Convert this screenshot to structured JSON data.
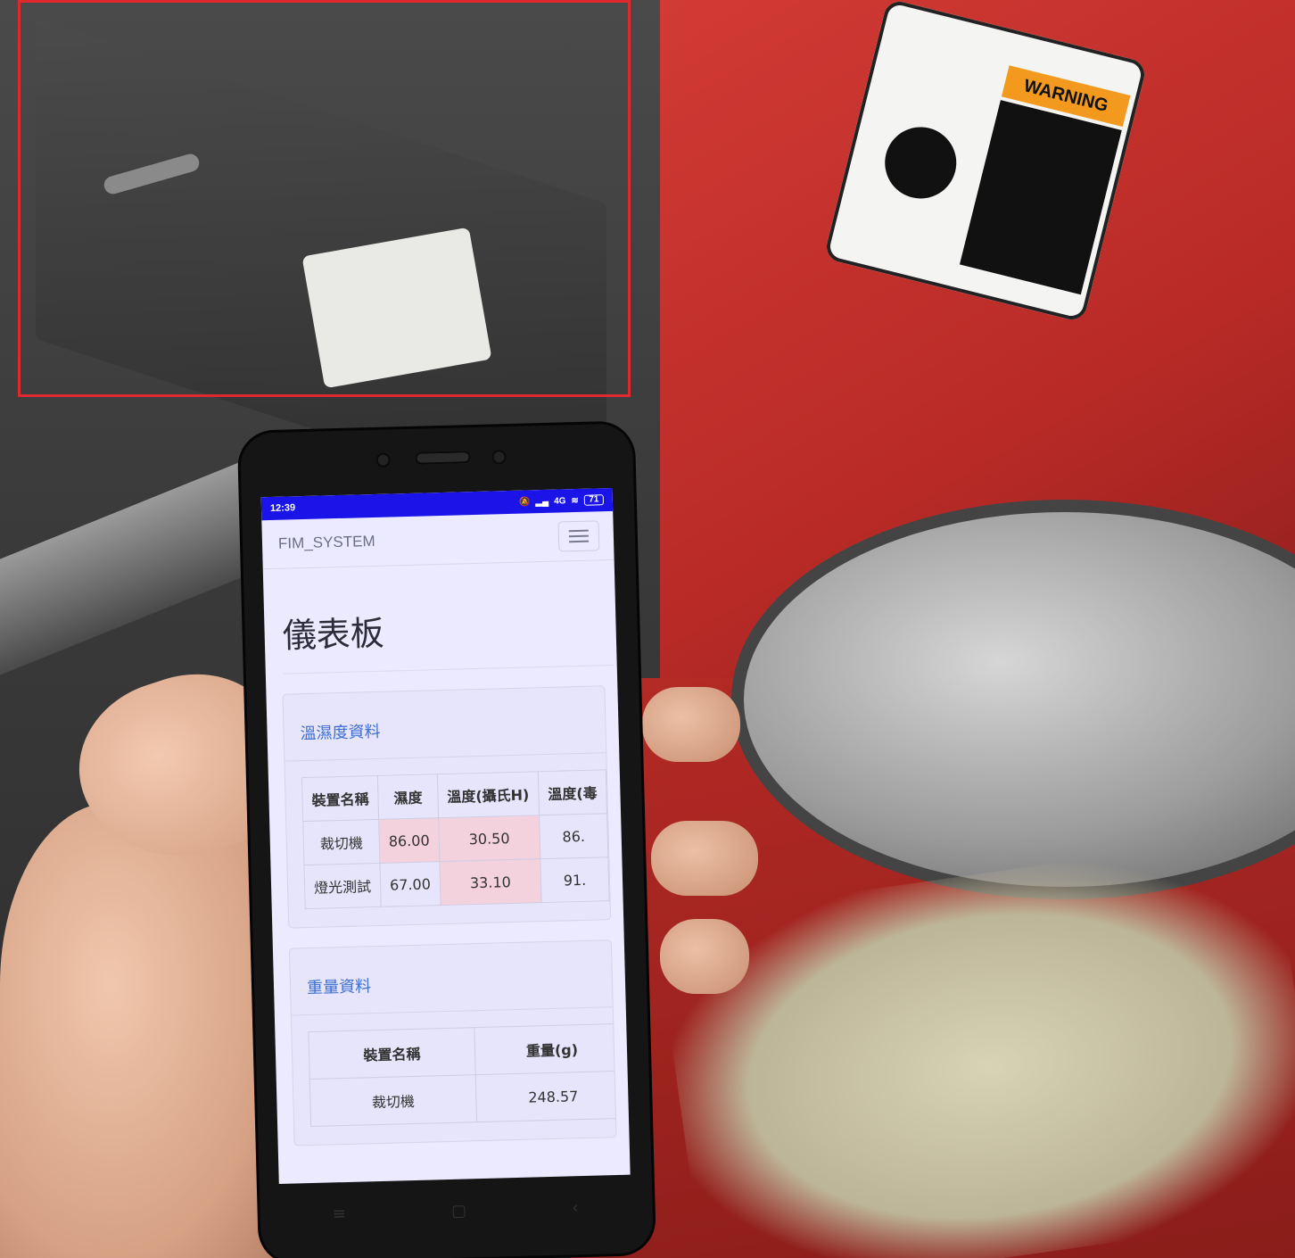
{
  "phone": {
    "status_time": "12:39",
    "status_network": "4G",
    "battery_level": "71",
    "brand": "FIM_SYSTEM",
    "page_title": "儀表板",
    "humidity_card": {
      "title": "溫濕度資料",
      "columns": [
        "裝置名稱",
        "濕度",
        "溫度(攝氏H)",
        "溫度(毒"
      ],
      "rows": [
        {
          "device": "裁切機",
          "humidity": "86.00",
          "temp_c": "30.50",
          "temp_f": "86."
        },
        {
          "device": "燈光測試",
          "humidity": "67.00",
          "temp_c": "33.10",
          "temp_f": "91."
        }
      ]
    },
    "weight_card": {
      "title": "重量資料",
      "columns": [
        "裝置名稱",
        "重量(g)"
      ],
      "rows": [
        {
          "device": "裁切機",
          "weight": "248.57"
        }
      ]
    }
  },
  "background": {
    "warning_label": "WARNING",
    "highlight_color": "#e0282e"
  }
}
